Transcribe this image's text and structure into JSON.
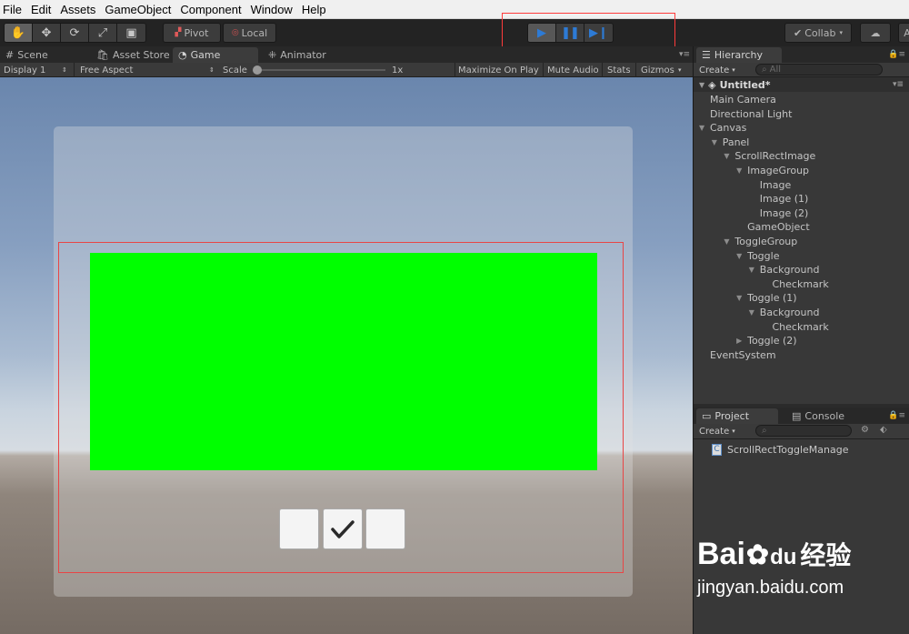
{
  "menu": [
    "File",
    "Edit",
    "Assets",
    "GameObject",
    "Component",
    "Window",
    "Help"
  ],
  "toolbar": {
    "pivot": "Pivot",
    "local": "Local",
    "collab": "Collab",
    "account_initial": "A"
  },
  "tabs": {
    "scene": "Scene",
    "asset_store": "Asset Store",
    "game": "Game",
    "animator": "Animator"
  },
  "game_toolbar": {
    "display": "Display 1",
    "aspect": "Free Aspect",
    "scale_label": "Scale",
    "scale_value": "1x",
    "maximize": "Maximize On Play",
    "mute": "Mute Audio",
    "stats": "Stats",
    "gizmos": "Gizmos"
  },
  "game_view": {
    "image_color": "#00ff00",
    "toggles_checked": [
      false,
      true,
      false
    ]
  },
  "hierarchy": {
    "title": "Hierarchy",
    "create": "Create",
    "search_placeholder": "All",
    "scene_name": "Untitled*",
    "items": [
      {
        "label": "Main Camera",
        "depth": 0,
        "arrow": ""
      },
      {
        "label": "Directional Light",
        "depth": 0,
        "arrow": ""
      },
      {
        "label": "Canvas",
        "depth": 0,
        "arrow": "open"
      },
      {
        "label": "Panel",
        "depth": 1,
        "arrow": "open"
      },
      {
        "label": "ScrollRectImage",
        "depth": 2,
        "arrow": "open"
      },
      {
        "label": "ImageGroup",
        "depth": 3,
        "arrow": "open"
      },
      {
        "label": "Image",
        "depth": 4,
        "arrow": ""
      },
      {
        "label": "Image (1)",
        "depth": 4,
        "arrow": ""
      },
      {
        "label": "Image (2)",
        "depth": 4,
        "arrow": ""
      },
      {
        "label": "GameObject",
        "depth": 3,
        "arrow": ""
      },
      {
        "label": "ToggleGroup",
        "depth": 2,
        "arrow": "open"
      },
      {
        "label": "Toggle",
        "depth": 3,
        "arrow": "open"
      },
      {
        "label": "Background",
        "depth": 4,
        "arrow": "open"
      },
      {
        "label": "Checkmark",
        "depth": 5,
        "arrow": ""
      },
      {
        "label": "Toggle (1)",
        "depth": 3,
        "arrow": "open"
      },
      {
        "label": "Background",
        "depth": 4,
        "arrow": "open"
      },
      {
        "label": "Checkmark",
        "depth": 5,
        "arrow": ""
      },
      {
        "label": "Toggle (2)",
        "depth": 3,
        "arrow": "closed"
      },
      {
        "label": "EventSystem",
        "depth": 0,
        "arrow": ""
      }
    ]
  },
  "project": {
    "tab_project": "Project",
    "tab_console": "Console",
    "create": "Create",
    "asset_name": "ScrollRectToggleManage"
  },
  "watermark": {
    "brand_en": "Bai",
    "brand_du": "du",
    "brand_cn": "经验",
    "url": "jingyan.baidu.com"
  }
}
